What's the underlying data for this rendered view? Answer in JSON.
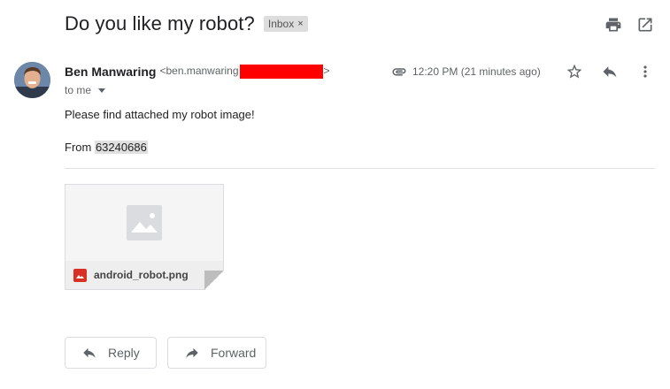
{
  "email": {
    "subject": "Do you like my robot?",
    "label": "Inbox",
    "label_remove": "×"
  },
  "sender": {
    "name": "Ben Manwaring",
    "email_prefix": "<ben.manwaring",
    "email_suffix": ">",
    "to_line": "to me",
    "time": "12:20 PM (21 minutes ago)"
  },
  "body": {
    "line1": "Please find attached my robot image!",
    "line2_prefix": "From ",
    "line2_number": "63240686"
  },
  "attachment": {
    "filename": "android_robot.png"
  },
  "actions": {
    "reply": "Reply",
    "forward": "Forward"
  },
  "icons": {
    "print": "print-icon",
    "open_new": "open-in-new-icon",
    "attachment": "paperclip-icon",
    "star": "star-icon",
    "reply": "reply-icon",
    "more": "more-vert-icon",
    "image": "image-icon",
    "forward": "forward-icon"
  },
  "colors": {
    "redaction": "#ff0000",
    "image_file": "#d93025"
  }
}
